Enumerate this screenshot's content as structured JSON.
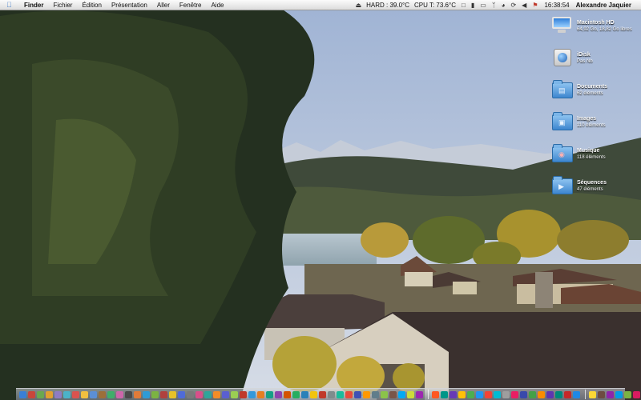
{
  "menubar": {
    "apple_icon": "apple-icon",
    "menus": [
      "Finder",
      "Fichier",
      "Édition",
      "Présentation",
      "Aller",
      "Fenêtre",
      "Aide"
    ],
    "status_hard": "HARD : 39.0°C",
    "status_cpu": "CPU T: 73.6°C",
    "clock": "16:38:54",
    "user": "Alexandre Jaquier",
    "status_icons": [
      "eject-icon",
      "box-icon",
      "bar-icon",
      "display-icon",
      "bluetooth-icon",
      "wifi-icon",
      "sync-icon",
      "volume-icon",
      "flag-icon"
    ]
  },
  "desktop": {
    "icons": [
      {
        "name": "Macintosh HD",
        "sub": "64,92 Go, 18,82 Go libres",
        "icon": "hard-drive-icon"
      },
      {
        "name": "iDisk",
        "sub": "Pas Nb",
        "icon": "idisk-icon"
      },
      {
        "name": "Documents",
        "sub": "62 éléments",
        "icon": "folder-documents-icon"
      },
      {
        "name": "Images",
        "sub": "110 éléments",
        "icon": "folder-pictures-icon"
      },
      {
        "name": "Musique",
        "sub": "118 éléments",
        "icon": "folder-music-icon"
      },
      {
        "name": "Séquences",
        "sub": "47 éléments",
        "icon": "folder-movies-icon"
      }
    ]
  },
  "dock": {
    "colors": [
      "#3a7fd5",
      "#c9463b",
      "#6aa84f",
      "#e0a030",
      "#8e7cc3",
      "#4bb3c9",
      "#d9534f",
      "#f0c040",
      "#5b8fd6",
      "#9c6f3a",
      "#3fae6a",
      "#cc66aa",
      "#4a4a4a",
      "#e07b39",
      "#2e9bd6",
      "#7cb342",
      "#b0413e",
      "#e6c229",
      "#4f6bd8",
      "#7a7a7a",
      "#d94f8a",
      "#2fa59a",
      "#f28c28",
      "#5a5fd0",
      "#9bcf53",
      "#c0392b",
      "#3498db",
      "#e67e22",
      "#16a085",
      "#8e44ad",
      "#d35400",
      "#27ae60",
      "#2980b9",
      "#f1c40f",
      "#c0392b",
      "#7f8c8d",
      "#1abc9c",
      "#e74c3c",
      "#3f51b5",
      "#ff9800",
      "#607d8b",
      "#8bc34a",
      "#795548",
      "#03a9f4",
      "#cddc39",
      "#9c27b0",
      "#ff5722",
      "#009688",
      "#673ab7",
      "#ffc107",
      "#4caf50",
      "#2196f3",
      "#f44336",
      "#00bcd4",
      "#9e9e9e",
      "#e91e63",
      "#3949ab",
      "#43a047",
      "#fb8c00",
      "#5e35b1",
      "#00897b",
      "#c62828",
      "#1e88e5",
      "#fdd835",
      "#6d4c41",
      "#8e24aa",
      "#039be5",
      "#7cb342",
      "#d81b60",
      "#546e7a"
    ],
    "separators_after": [
      45,
      62
    ]
  }
}
